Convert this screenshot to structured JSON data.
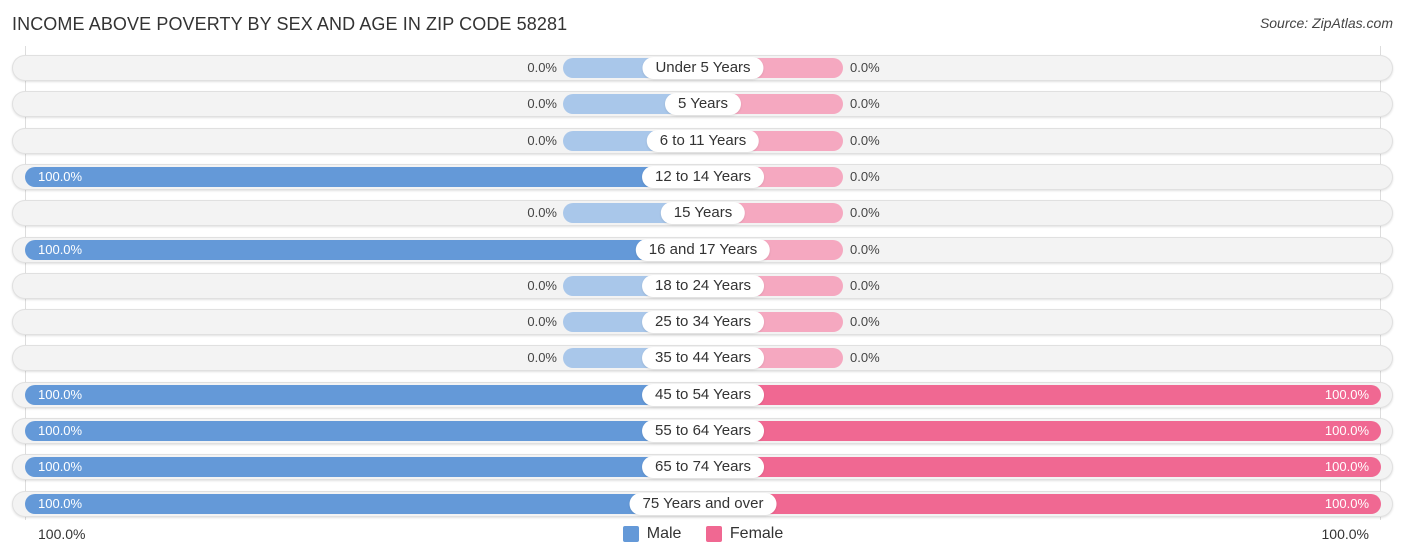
{
  "chart_data": {
    "type": "bar",
    "orientation": "horizontal-diverging",
    "title": "INCOME ABOVE POVERTY BY SEX AND AGE IN ZIP CODE 58281",
    "source": "Source: ZipAtlas.com",
    "categories": [
      "Under 5 Years",
      "5 Years",
      "6 to 11 Years",
      "12 to 14 Years",
      "15 Years",
      "16 and 17 Years",
      "18 to 24 Years",
      "25 to 34 Years",
      "35 to 44 Years",
      "45 to 54 Years",
      "55 to 64 Years",
      "65 to 74 Years",
      "75 Years and over"
    ],
    "series": [
      {
        "name": "Male",
        "color": "#6499d8",
        "zero_color": "#a9c7ea",
        "values": [
          0,
          0,
          0,
          100,
          0,
          100,
          0,
          0,
          0,
          100,
          100,
          100,
          100
        ],
        "labels": [
          "0.0%",
          "0.0%",
          "0.0%",
          "100.0%",
          "0.0%",
          "100.0%",
          "0.0%",
          "0.0%",
          "0.0%",
          "100.0%",
          "100.0%",
          "100.0%",
          "100.0%"
        ]
      },
      {
        "name": "Female",
        "color": "#f06892",
        "zero_color": "#f5a8c0",
        "values": [
          0,
          0,
          0,
          0,
          0,
          0,
          0,
          0,
          0,
          100,
          100,
          100,
          100
        ],
        "labels": [
          "0.0%",
          "0.0%",
          "0.0%",
          "0.0%",
          "0.0%",
          "0.0%",
          "0.0%",
          "0.0%",
          "0.0%",
          "100.0%",
          "100.0%",
          "100.0%",
          "100.0%"
        ]
      }
    ],
    "xlim": [
      0,
      100
    ],
    "axis_left_label": "100.0%",
    "axis_right_label": "100.0%",
    "legend": [
      "Male",
      "Female"
    ],
    "legend_position": "bottom-center"
  }
}
